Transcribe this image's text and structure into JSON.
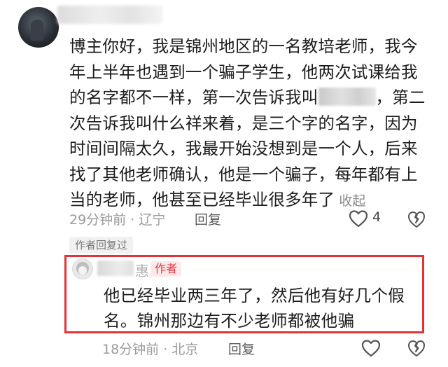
{
  "comment": {
    "text_parts": [
      "博主你好，我是锦州地区的一名教培老师，我今年上半年也遇到一个骗子学生，他两次试课给我的名字都不一样，第一次告诉我叫",
      "，第二次告诉我叫什么祥来着，是三个字的名字，因为时间间隔太久，我最开始没想到是一个人，后来找了其他老师确认，他是一个骗子，每年都有上当的老师，他甚至已经毕业很多年了"
    ],
    "collapse_label": "收起",
    "time": "29分钟前",
    "location": "辽宁",
    "reply_label": "回复",
    "like_count": "4",
    "author_replied_label": "作者回复过"
  },
  "reply": {
    "name_tail": "惠",
    "author_badge": "作者",
    "text": "他已经毕业两三年了，然后他有好几个假名。锦州那边有不少老师都被他骗",
    "time": "18分钟前",
    "location": "北京",
    "reply_label": "回复"
  },
  "colors": {
    "highlight_border": "#e53238",
    "author_badge_text": "#e8373d",
    "author_badge_bg": "#fde9ea",
    "meta_text": "#9a9a9a"
  },
  "icons": [
    "heart-outline-icon",
    "broken-heart-icon"
  ]
}
